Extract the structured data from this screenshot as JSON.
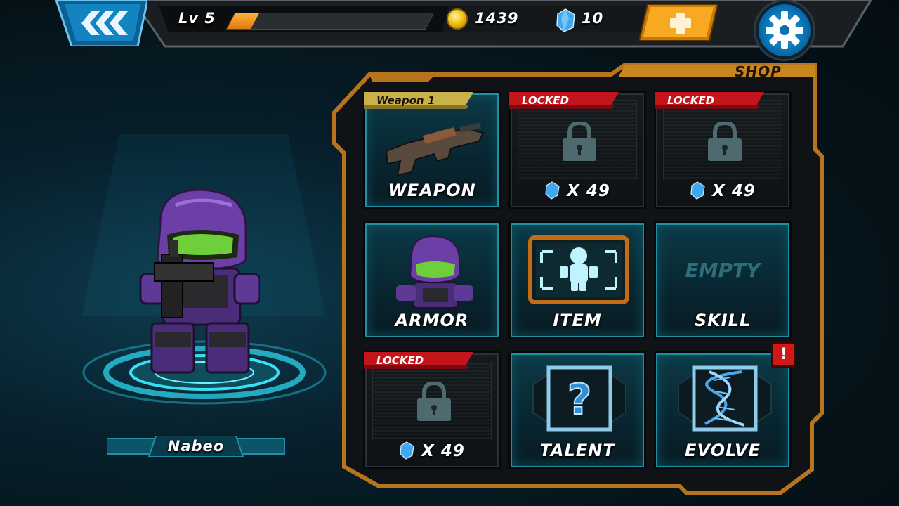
{
  "player": {
    "level_label": "Lv 5",
    "xp_progress": 0.12,
    "coins": "1439",
    "gems": "10",
    "name": "Nabeo"
  },
  "shop": {
    "title": "SHOP"
  },
  "cells": {
    "weapon": {
      "ribbon": "Weapon 1",
      "label": "WEAPON"
    },
    "locked1": {
      "ribbon": "LOCKED",
      "cost": "X 49"
    },
    "locked2": {
      "ribbon": "LOCKED",
      "cost": "X 49"
    },
    "armor": {
      "label": "ARMOR"
    },
    "item": {
      "label": "ITEM"
    },
    "skill": {
      "empty": "EMPTY",
      "label": "SKILL"
    },
    "locked3": {
      "ribbon": "LOCKED",
      "cost": "X 49"
    },
    "talent": {
      "label": "TALENT"
    },
    "evolve": {
      "label": "EVOLVE",
      "alert": "!"
    }
  },
  "colors": {
    "accent_orange": "#f5a623",
    "accent_blue": "#1aa5e6",
    "locked_red": "#c4141c",
    "weapon_gold": "#c9b24a",
    "frame_orange": "#b8741c"
  },
  "icons": [
    "back-arrows-icon",
    "coin-icon",
    "gem-icon",
    "plus-icon",
    "gear-icon",
    "lock-icon",
    "question-icon",
    "dna-icon",
    "alert-icon"
  ]
}
